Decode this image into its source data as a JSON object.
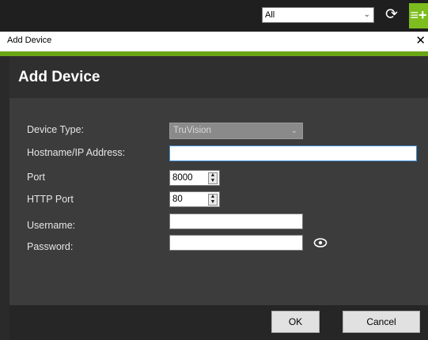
{
  "topbar": {
    "filter_value": "All",
    "chevron_icon": "chevron-down-icon",
    "refresh_icon": "refresh-icon",
    "add_icon": "add-list-icon",
    "add_glyph": "≡+",
    "accent_color": "#7dbd1e"
  },
  "window": {
    "title": "Add Device",
    "close_glyph": "✕"
  },
  "dialog": {
    "heading": "Add Device",
    "fields": {
      "device_type_label": "Device Type:",
      "device_type_value": "TruVision",
      "hostname_label": "Hostname/IP Address:",
      "hostname_value": "",
      "port_label": "Port",
      "port_value": "8000",
      "http_port_label": "HTTP Port",
      "http_port_value": "80",
      "username_label": "Username:",
      "username_value": "",
      "password_label": "Password:",
      "password_value": ""
    },
    "buttons": {
      "ok": "OK",
      "cancel": "Cancel"
    }
  }
}
